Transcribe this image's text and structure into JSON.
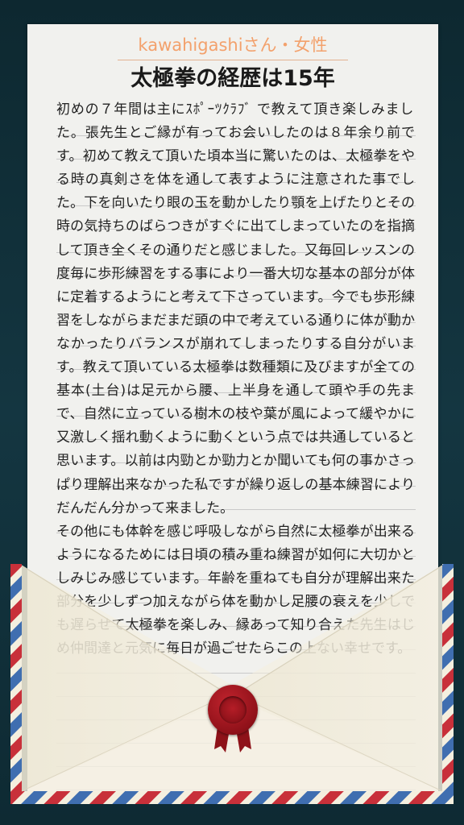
{
  "author": "kawahigashiさん・女性",
  "title": "太極拳の経歴は15年",
  "paragraph1": "初めの７年間は主にｽﾎﾟｰﾂｸﾗﾌﾞ で教えて頂き楽しみました。張先生とご縁が有ってお会いしたのは８年余り前です。初めて教えて頂いた頃本当に驚いたのは、太極拳をやる時の真剣さを体を通して表すように注意された事でした。下を向いたり眼の玉を動かしたり顎を上げたりとその時の気持ちのばらつきがすぐに出てしまっていたのを指摘して頂き全くその通りだと感じました。又毎回レッスンの度毎に歩形練習をする事により一番大切な基本の部分が体に定着するようにと考えて下さっています。今でも歩形練習をしながらまだまだ頭の中で考えている通りに体が動かなかったりバランスが崩れてしまったりする自分がいます。教えて頂いている太極拳は数種類に及びますが全ての基本(土台)は足元から腰、上半身を通して頭や手の先まで、自然に立っている樹木の枝や葉が風によって緩やかに又激しく揺れ動くように動くという点では共通していると思います。以前は内勁とか勁力とか聞いても何の事かさっぱり理解出来なかった私ですが繰り返しの基本練習によりだんだん分かって来ました。",
  "paragraph2": "その他にも体幹を感じ呼吸しながら自然に太極拳が出来るようになるためには日頃の積み重ね練習が如何に大切かとしみじみ感じています。年齢を重ねても自分が理解出来た部分を少しずつ加えながら体を動かし足腰の衰えを少しでも遅らせて太極拳を楽しみ、縁あって知り合えた先生はじめ仲間達と元気に毎日が過ごせたらこの上ない幸せです。",
  "colors": {
    "background": "#102e37",
    "paper": "#f1f1ee",
    "author_accent": "#f3a16c",
    "envelope": "#f4efdf",
    "airmail_red": "#c8303a",
    "airmail_blue": "#3f6eb0",
    "seal": "#a8161f"
  },
  "icons": {
    "seal": "wax-seal-icon"
  }
}
